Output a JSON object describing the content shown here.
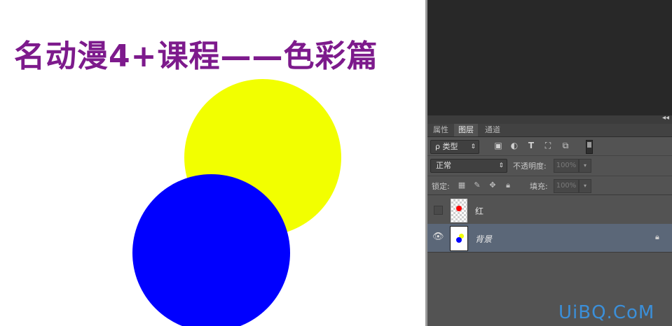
{
  "canvas": {
    "title": "名动漫4+课程——色彩篇",
    "background": "#ffffff",
    "title_color": "#7d1a8c",
    "yellow_circle_color": "#f2ff00",
    "blue_circle_color": "#0000ff"
  },
  "layers_panel": {
    "tabs": [
      {
        "label": "属性",
        "active": false
      },
      {
        "label": "图层",
        "active": true
      },
      {
        "label": "通道",
        "active": false
      }
    ],
    "filter": {
      "label": "ρ 类型",
      "arrow": "⇕"
    },
    "filter_icons": [
      "image-filter-icon",
      "adjustment-filter-icon",
      "type-filter-icon",
      "shape-filter-icon",
      "smart-object-filter-icon"
    ],
    "blend_mode": "正常",
    "opacity_label": "不透明度:",
    "opacity_value": "100%",
    "lock_label": "锁定:",
    "fill_label": "填充:",
    "fill_value": "100%",
    "layers": [
      {
        "name": "红",
        "visible": false,
        "thumb_dot": "#ff0000",
        "selected": false
      },
      {
        "name": "背景",
        "visible": true,
        "selected": true,
        "locked": true
      }
    ],
    "colors": {
      "panel_bg": "#535353",
      "selected_layer_bg": "#5b6778",
      "dark_area": "#282828"
    }
  },
  "watermark": {
    "text": "UiBQ.CoM",
    "color": "#3b8fd9"
  }
}
